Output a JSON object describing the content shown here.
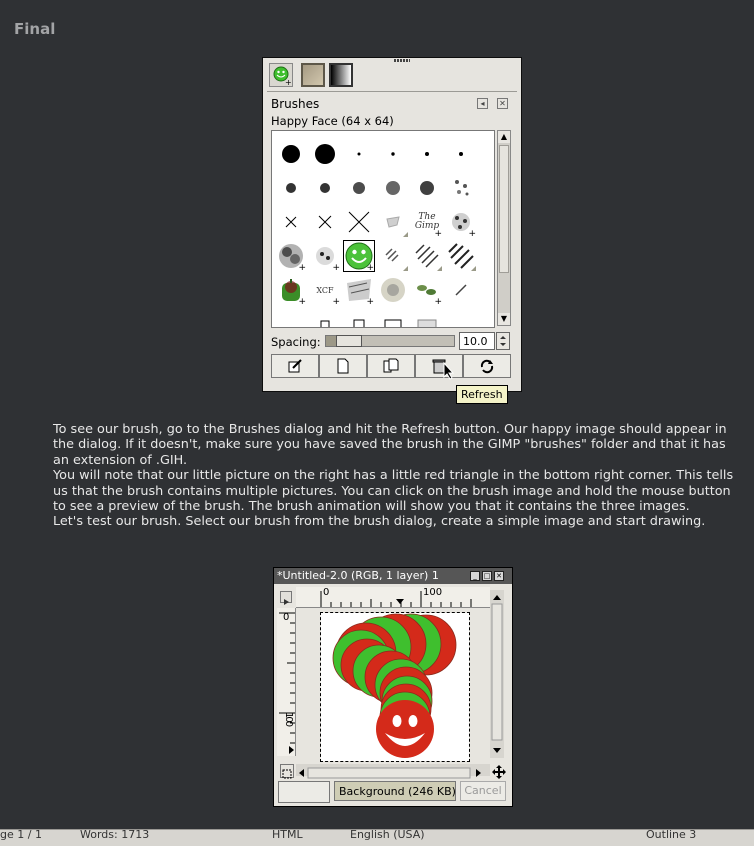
{
  "section_title": "Final",
  "brushes": {
    "title": "Brushes",
    "brush_name": "Happy Face (64 x 64)",
    "spacing_label": "Spacing:",
    "spacing_value": "10.0",
    "spacing_fraction": 0.1,
    "tooltip": "Refresh",
    "actions": [
      "edit-brush",
      "new-brush",
      "duplicate-brush",
      "delete-brush",
      "refresh-brushes"
    ],
    "xcf_label": "XCF",
    "gimp_label": "The Gimp"
  },
  "body_text": {
    "p1": "To see our brush, go to the Brushes dialog and hit the Refresh button. Our happy image should appear in the dialog. If it doesn't, make sure you have saved the brush in the GIMP \"brushes\" folder and that it has an extension of .GIH.",
    "p2": "You will note that our little picture on the right has a little red triangle in the bottom right corner. This tells us that the brush contains multiple pictures. You can click on the brush image and hold the mouse button to see a preview of the brush. The brush animation will show you that it contains the three images.",
    "p3": "Let's test our brush. Select our brush from the brush dialog, create a simple image and start drawing."
  },
  "image_window": {
    "title": "*Untitled-2.0 (RGB, 1 layer) 1",
    "ruler_h_0": "0",
    "ruler_h_100": "100",
    "ruler_v_0": "0",
    "ruler_v_100": "100",
    "layer_info": "Background (246 KB)",
    "cancel_label": "Cancel"
  },
  "statusbar": {
    "page": "ge 1 / 1",
    "words": "Words: 1713",
    "format": "HTML",
    "language": "English (USA)",
    "outline": "Outline 3"
  },
  "colors": {
    "red": "#d42a1a",
    "green": "#3fbf2e"
  }
}
